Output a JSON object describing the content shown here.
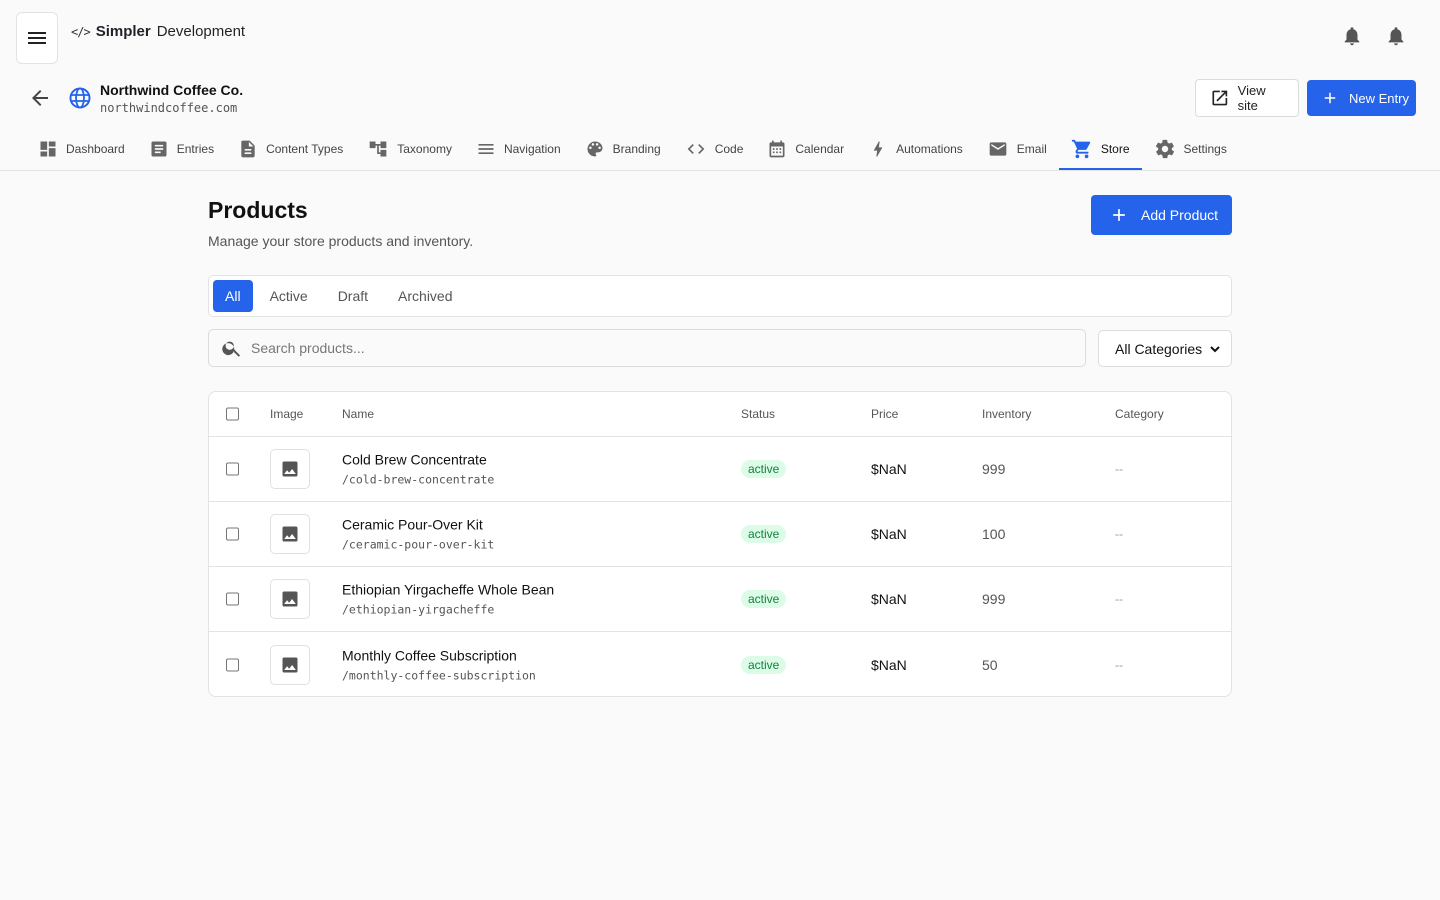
{
  "app": {
    "brand_code": "</>",
    "brand_bold": "Simpler",
    "brand_rest": "Development"
  },
  "site": {
    "name": "Northwind Coffee Co.",
    "domain": "northwindcoffee.com"
  },
  "actions": {
    "view_site": "View site",
    "new_entry": "New Entry"
  },
  "nav": {
    "tabs": [
      {
        "label": "Dashboard",
        "icon": "dashboard-icon"
      },
      {
        "label": "Entries",
        "icon": "entries-icon"
      },
      {
        "label": "Content Types",
        "icon": "document-icon"
      },
      {
        "label": "Taxonomy",
        "icon": "taxonomy-icon"
      },
      {
        "label": "Navigation",
        "icon": "menu-lines-icon"
      },
      {
        "label": "Branding",
        "icon": "palette-icon"
      },
      {
        "label": "Code",
        "icon": "code-icon"
      },
      {
        "label": "Calendar",
        "icon": "calendar-icon"
      },
      {
        "label": "Automations",
        "icon": "bolt-icon"
      },
      {
        "label": "Email",
        "icon": "mail-icon"
      },
      {
        "label": "Store",
        "icon": "cart-icon"
      },
      {
        "label": "Settings",
        "icon": "gear-icon"
      }
    ],
    "active": "Store"
  },
  "page": {
    "title": "Products",
    "subtitle": "Manage your store products and inventory.",
    "add_button": "Add Product"
  },
  "filters": {
    "tabs": [
      "All",
      "Active",
      "Draft",
      "Archived"
    ],
    "active": "All",
    "search_placeholder": "Search products...",
    "category_selected": "All Categories"
  },
  "table": {
    "headers": [
      "Image",
      "Name",
      "Status",
      "Price",
      "Inventory",
      "Category"
    ],
    "rows": [
      {
        "name": "Cold Brew Concentrate",
        "slug": "/cold-brew-concentrate",
        "status": "active",
        "price": "$NaN",
        "inventory": "999",
        "category": "--"
      },
      {
        "name": "Ceramic Pour-Over Kit",
        "slug": "/ceramic-pour-over-kit",
        "status": "active",
        "price": "$NaN",
        "inventory": "100",
        "category": "--"
      },
      {
        "name": "Ethiopian Yirgacheffe Whole Bean",
        "slug": "/ethiopian-yirgacheffe",
        "status": "active",
        "price": "$NaN",
        "inventory": "999",
        "category": "--"
      },
      {
        "name": "Monthly Coffee Subscription",
        "slug": "/monthly-coffee-subscription",
        "status": "active",
        "price": "$NaN",
        "inventory": "50",
        "category": "--"
      }
    ]
  },
  "colors": {
    "accent": "#2563eb",
    "badge_bg": "#dcfce7",
    "badge_text": "#15803d"
  }
}
